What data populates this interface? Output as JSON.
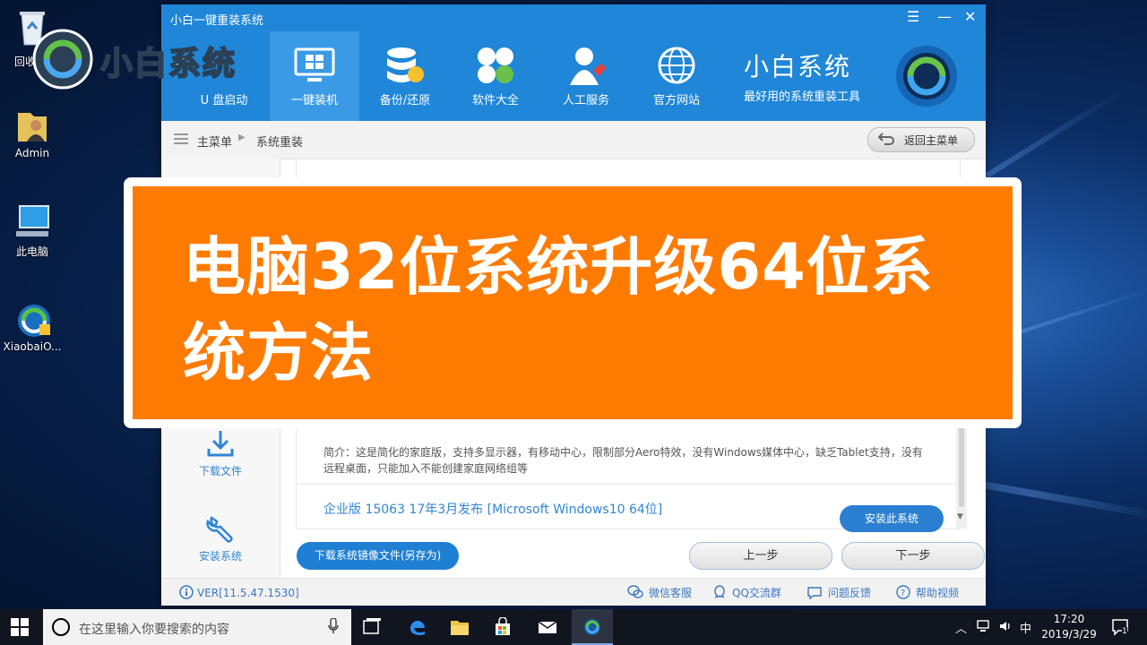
{
  "desktop": {
    "icons": [
      {
        "label": "回收站",
        "icon": "recycle-bin-icon"
      },
      {
        "label": "Admin",
        "icon": "user-folder-icon"
      },
      {
        "label": "此电脑",
        "icon": "computer-icon"
      },
      {
        "label": "XiaobaiO...",
        "icon": "xiaobai-app-icon"
      }
    ],
    "watermark": "小白系统"
  },
  "app": {
    "title": "小白一键重装系统",
    "nav": [
      {
        "label": "U 盘启动",
        "icon": "usb-drive-icon",
        "active": false
      },
      {
        "label": "一键装机",
        "icon": "monitor-windows-icon",
        "active": true
      },
      {
        "label": "备份/还原",
        "icon": "database-backup-icon",
        "active": false
      },
      {
        "label": "软件大全",
        "icon": "apps-grid-icon",
        "active": false
      },
      {
        "label": "人工服务",
        "icon": "support-person-icon",
        "active": false
      },
      {
        "label": "官方网站",
        "icon": "globe-icon",
        "active": false
      }
    ],
    "brand": {
      "name": "小白系统",
      "slogan": "最好用的系统重装工具"
    },
    "breadcrumb": {
      "root": "主菜单",
      "current": "系统重装"
    },
    "back_label": "返回主菜单",
    "sidebar": [
      {
        "label": "下载文件",
        "icon": "download-icon"
      },
      {
        "label": "安装系统",
        "icon": "wrench-icon"
      }
    ],
    "description": "简介：这是简化的家庭版，支持多显示器，有移动中心，限制部分Aero特效，没有Windows媒体中心，缺乏Tablet支持，没有远程桌面，只能加入不能创建家庭网络组等",
    "edition": "企业版 15063 17年3月发布 [Microsoft Windows10 64位]",
    "install_label": "安装此系统",
    "download_image_label": "下载系统镜像文件(另存为)",
    "prev_label": "上一步",
    "next_label": "下一步",
    "status": {
      "version": "VER[11.5.47.1530]",
      "links": [
        {
          "label": "微信客服",
          "icon": "wechat-icon"
        },
        {
          "label": "QQ交流群",
          "icon": "qq-icon"
        },
        {
          "label": "问题反馈",
          "icon": "feedback-icon"
        },
        {
          "label": "帮助视频",
          "icon": "help-icon"
        }
      ]
    }
  },
  "banner": {
    "title_line1": "电脑32位系统升级64位系",
    "title_line2": "统方法"
  },
  "taskbar": {
    "search_placeholder": "在这里输入你要搜索的内容",
    "ime": "中",
    "time": "17:20",
    "date": "2019/3/29",
    "notification_count": "1"
  },
  "colors": {
    "accent": "#1f86d8",
    "banner": "#ff7b00"
  }
}
